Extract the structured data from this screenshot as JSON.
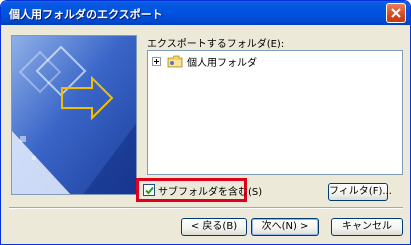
{
  "window": {
    "title": "個人用フォルダのエクスポート"
  },
  "export": {
    "folder_label": "エクスポートするフォルダ(E):",
    "tree_items": [
      {
        "label": "個人用フォルダ",
        "expanded": false
      }
    ]
  },
  "options": {
    "include_subfolders_label": "サブフォルダを含む(S)",
    "include_subfolders_checked": true,
    "filter_label": "フィルタ(F)..."
  },
  "footer": {
    "back_label": "< 戻る(B)",
    "next_label": "次へ(N) >",
    "cancel_label": "キャンセル"
  },
  "colors": {
    "titlebar": "#0054e3",
    "highlight": "#e0001b",
    "dialog_bg": "#ece9d8"
  }
}
